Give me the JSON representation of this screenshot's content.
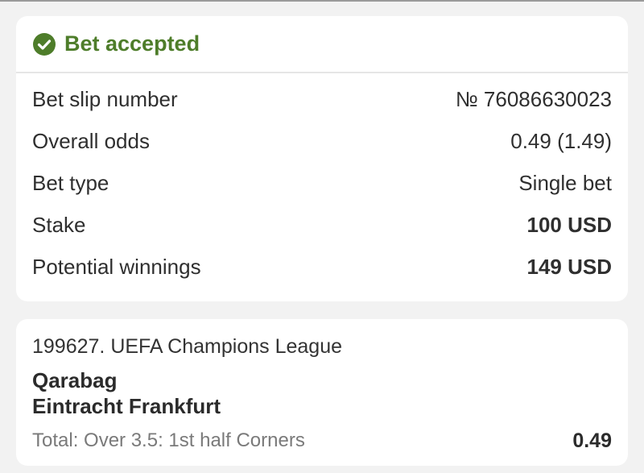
{
  "status": {
    "title": "Bet accepted",
    "icon": "check-circle-icon",
    "accent_color": "#4e7d2a"
  },
  "summary": {
    "rows": [
      {
        "label": "Bet slip number",
        "value": "№ 76086630023"
      },
      {
        "label": "Overall odds",
        "value": "0.49 (1.49)"
      },
      {
        "label": "Bet type",
        "value": "Single bet"
      },
      {
        "label": "Stake",
        "value": "100 USD"
      },
      {
        "label": "Potential winnings",
        "value": "149 USD"
      }
    ]
  },
  "event": {
    "league": "199627. UEFA Champions League",
    "team_home": "Qarabag",
    "team_away": "Eintracht Frankfurt",
    "market": "Total: Over 3.5: 1st half Corners",
    "odds": "0.49"
  }
}
